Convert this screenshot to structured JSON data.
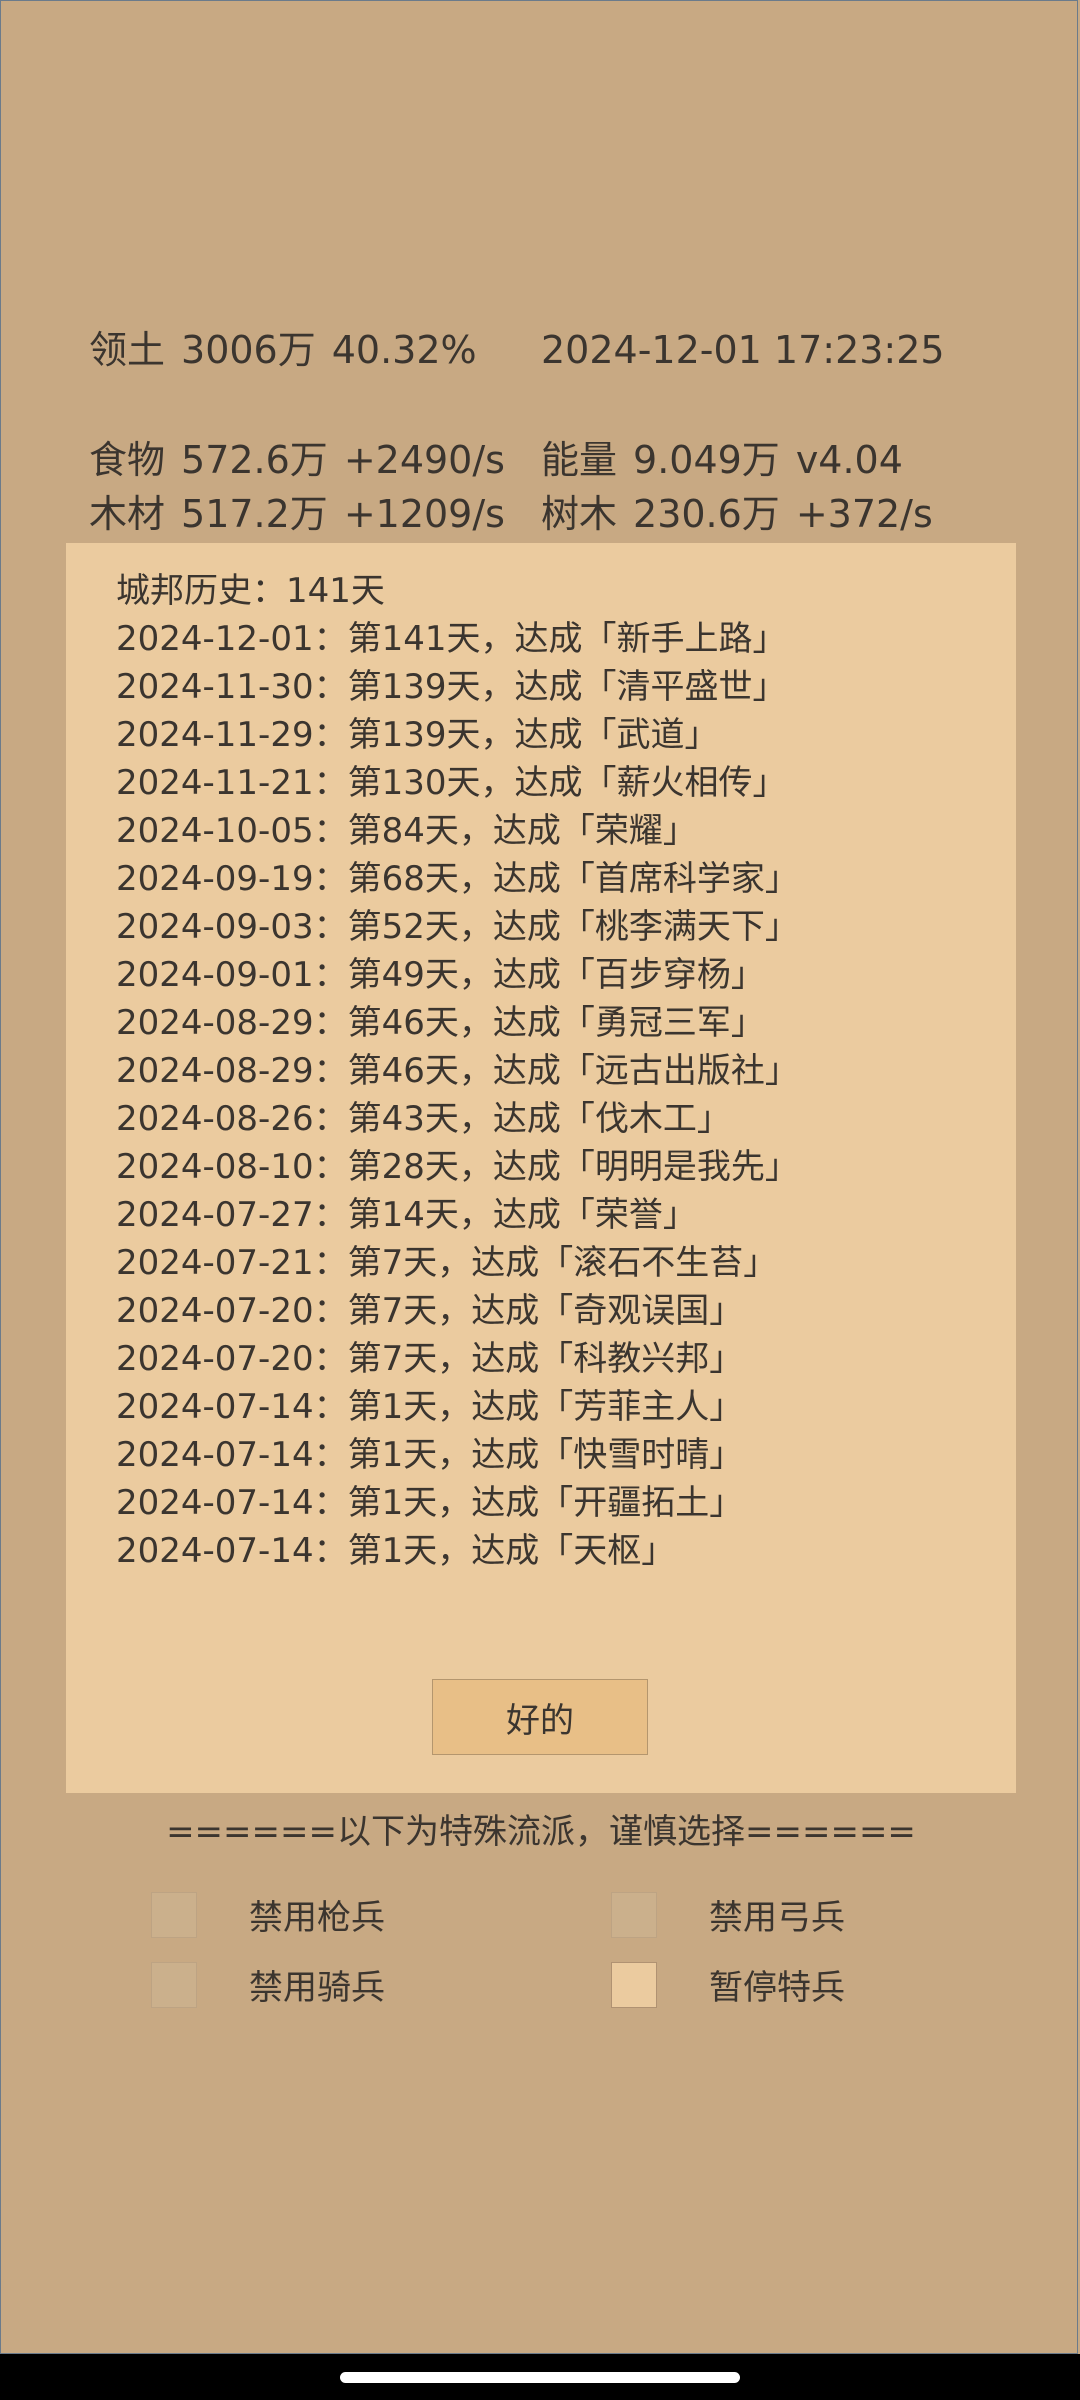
{
  "stats": {
    "territory": {
      "label": "领土",
      "value": "3006万",
      "percent": "40.32%"
    },
    "datetime": "2024-12-01 17:23:25",
    "food": {
      "label": "食物",
      "value": "572.6万",
      "rate": "+2490/s"
    },
    "energy": {
      "label": "能量",
      "value": "9.049万",
      "version": "v4.04"
    },
    "wood": {
      "label": "木材",
      "value": "517.2万",
      "rate": "+1209/s"
    },
    "trees": {
      "label": "树木",
      "value": "230.6万",
      "rate": "+372/s"
    }
  },
  "history": {
    "title": "城邦历史：141天",
    "entries": [
      "2024-12-01：第141天，达成「新手上路」",
      "2024-11-30：第139天，达成「清平盛世」",
      "2024-11-29：第139天，达成「武道」",
      "2024-11-21：第130天，达成「薪火相传」",
      "2024-10-05：第84天，达成「荣耀」",
      "2024-09-19：第68天，达成「首席科学家」",
      "2024-09-03：第52天，达成「桃李满天下」",
      "2024-09-01：第49天，达成「百步穿杨」",
      "2024-08-29：第46天，达成「勇冠三军」",
      "2024-08-29：第46天，达成「远古出版社」",
      "2024-08-26：第43天，达成「伐木工」",
      "2024-08-10：第28天，达成「明明是我先」",
      "2024-07-27：第14天，达成「荣誉」",
      "2024-07-21：第7天，达成「滚石不生苔」",
      "2024-07-20：第7天，达成「奇观误国」",
      "2024-07-20：第7天，达成「科教兴邦」",
      "2024-07-14：第1天，达成「芳菲主人」",
      "2024-07-14：第1天，达成「快雪时晴」",
      "2024-07-14：第1天，达成「开疆拓土」",
      "2024-07-14：第1天，达成「天枢」"
    ],
    "ok_label": "好的"
  },
  "special": {
    "title": "======以下为特殊流派，谨慎选择======",
    "options": [
      {
        "label": "禁用枪兵",
        "checked": false
      },
      {
        "label": "禁用弓兵",
        "checked": false
      },
      {
        "label": "禁用骑兵",
        "checked": false
      },
      {
        "label": "暂停特兵",
        "checked": true
      }
    ]
  },
  "colors": {
    "background": "#c8a983",
    "panel": "#ebcb9f",
    "button": "#e8bf87",
    "text": "#3b352f"
  }
}
